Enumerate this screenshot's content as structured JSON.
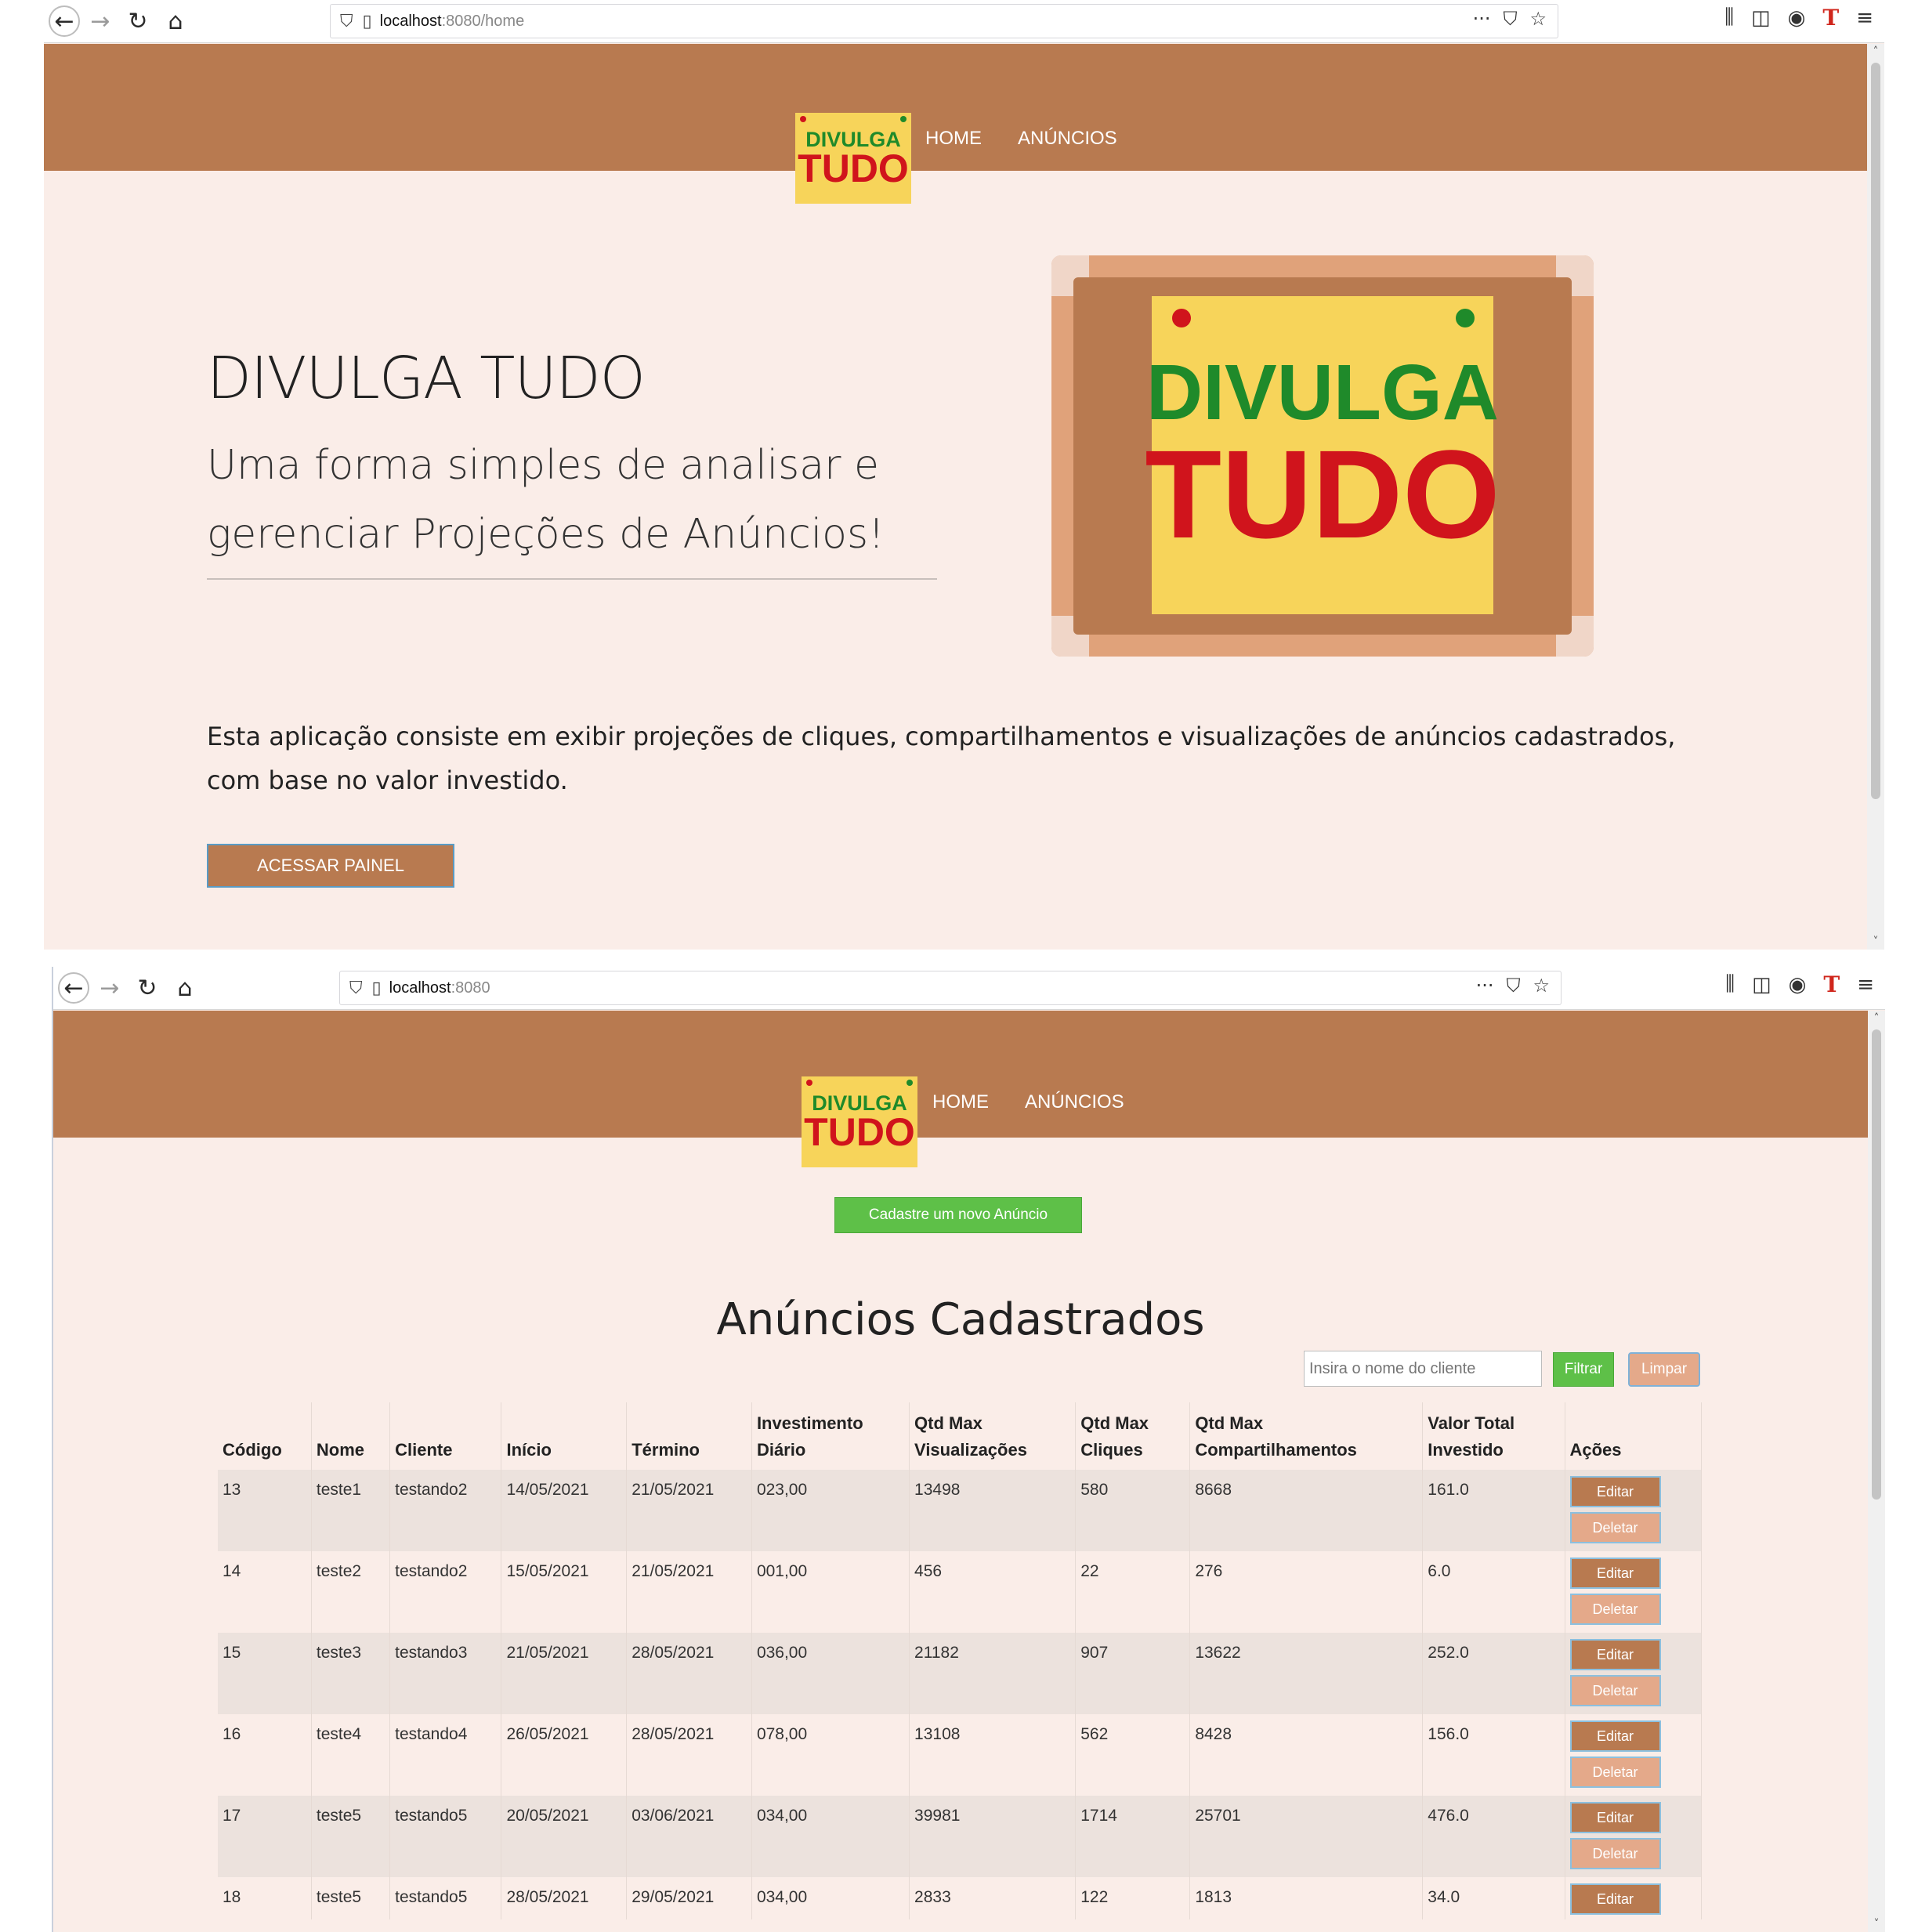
{
  "window1": {
    "url_host": "localhost",
    "url_path": ":8080/home",
    "nav": {
      "home": "HOME",
      "ads": "ANÚNCIOS"
    },
    "logo": {
      "line1": "DIVULGA",
      "line2": "TUDO"
    },
    "hero": {
      "title": "DIVULGA TUDO",
      "subtitle": "Uma forma simples de analisar e gerenciar Projeções de Anúncios!",
      "description": "Esta aplicação consiste em exibir projeções de cliques, compartilhamentos e visualizações de anúncios cadastrados, com base no valor investido.",
      "button": "ACESSAR PAINEL"
    },
    "board_logo": {
      "line1": "DIVULGA",
      "line2": "TUDO"
    }
  },
  "window2": {
    "url_host": "localhost",
    "url_path": ":8080",
    "nav": {
      "home": "HOME",
      "ads": "ANÚNCIOS"
    },
    "logo": {
      "line1": "DIVULGA",
      "line2": "TUDO"
    },
    "new_button": "Cadastre um novo Anúncio",
    "title": "Anúncios Cadastrados",
    "filter": {
      "placeholder": "Insira o nome do cliente",
      "filter_label": "Filtrar",
      "clear_label": "Limpar"
    },
    "table": {
      "headers": [
        "Código",
        "Nome",
        "Cliente",
        "Início",
        "Término",
        "Investimento Diário",
        "Qtd Max Visualizações",
        "Qtd Max Cliques",
        "Qtd Max Compartilhamentos",
        "Valor Total Investido",
        "Ações"
      ],
      "edit_label": "Editar",
      "delete_label": "Deletar",
      "rows": [
        [
          "13",
          "teste1",
          "testando2",
          "14/05/2021",
          "21/05/2021",
          "023,00",
          "13498",
          "580",
          "8668",
          "161.0"
        ],
        [
          "14",
          "teste2",
          "testando2",
          "15/05/2021",
          "21/05/2021",
          "001,00",
          "456",
          "22",
          "276",
          "6.0"
        ],
        [
          "15",
          "teste3",
          "testando3",
          "21/05/2021",
          "28/05/2021",
          "036,00",
          "21182",
          "907",
          "13622",
          "252.0"
        ],
        [
          "16",
          "teste4",
          "testando4",
          "26/05/2021",
          "28/05/2021",
          "078,00",
          "13108",
          "562",
          "8428",
          "156.0"
        ],
        [
          "17",
          "teste5",
          "testando5",
          "20/05/2021",
          "03/06/2021",
          "034,00",
          "39981",
          "1714",
          "25701",
          "476.0"
        ],
        [
          "18",
          "teste5",
          "testando5",
          "28/05/2021",
          "29/05/2021",
          "034,00",
          "2833",
          "122",
          "1813",
          "34.0"
        ]
      ]
    }
  },
  "colors": {
    "brand_brown": "#b87a50",
    "page_bg": "#faede8",
    "logo_yellow": "#f7d45a",
    "logo_green": "#1f8a2a",
    "logo_red": "#d0141c",
    "button_green": "#5ec048",
    "button_peach": "#e4a98a"
  },
  "icons": [
    "back-arrow-icon",
    "forward-arrow-icon",
    "reload-icon",
    "home-icon",
    "shield-icon",
    "page-icon",
    "more-icon",
    "pocket-icon",
    "star-icon",
    "library-icon",
    "sidebar-icon",
    "account-icon",
    "t-extension-icon",
    "menu-icon"
  ]
}
